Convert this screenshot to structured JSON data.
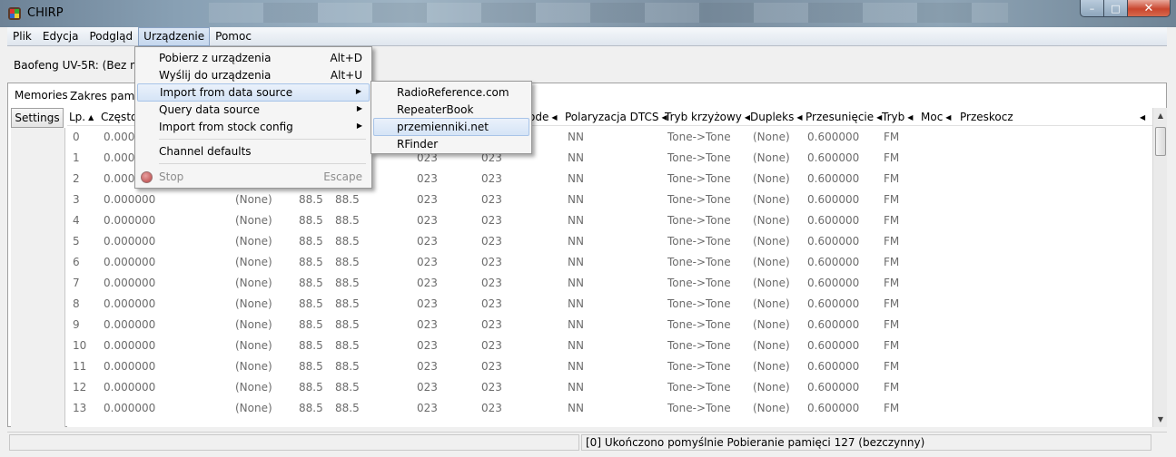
{
  "window": {
    "title": "CHIRP",
    "min": "–",
    "max": "□",
    "close": "✕"
  },
  "menubar": {
    "items": [
      "Plik",
      "Edycja",
      "Podgląd",
      "Urządzenie",
      "Pomoc"
    ]
  },
  "radio": {
    "label": "Baofeng UV-5R: (Bez nazw"
  },
  "tabs": {
    "memories": "Memories",
    "bank": "Zakres pamięć",
    "settings": "Settings"
  },
  "grid": {
    "headers": [
      "Lp.",
      "Częstot",
      "ode",
      "Polaryzacja DTCS",
      "Tryb krzyżowy",
      "Dupleks",
      "Przesunięcie",
      "Tryb",
      "Moc",
      "Przeskocz"
    ],
    "rows": [
      [
        "0",
        "0.00000",
        "",
        "",
        "",
        "",
        "",
        "NN",
        "Tone->Tone",
        "(None)",
        "0.600000",
        "FM"
      ],
      [
        "1",
        "0.00000",
        "",
        "",
        "",
        "023",
        "023",
        "NN",
        "Tone->Tone",
        "(None)",
        "0.600000",
        "FM"
      ],
      [
        "2",
        "0.00000",
        "",
        "",
        "",
        "023",
        "023",
        "NN",
        "Tone->Tone",
        "(None)",
        "0.600000",
        "FM"
      ],
      [
        "3",
        "0.000000",
        "(None)",
        "88.5",
        "88.5",
        "023",
        "023",
        "NN",
        "Tone->Tone",
        "(None)",
        "0.600000",
        "FM"
      ],
      [
        "4",
        "0.000000",
        "(None)",
        "88.5",
        "88.5",
        "023",
        "023",
        "NN",
        "Tone->Tone",
        "(None)",
        "0.600000",
        "FM"
      ],
      [
        "5",
        "0.000000",
        "(None)",
        "88.5",
        "88.5",
        "023",
        "023",
        "NN",
        "Tone->Tone",
        "(None)",
        "0.600000",
        "FM"
      ],
      [
        "6",
        "0.000000",
        "(None)",
        "88.5",
        "88.5",
        "023",
        "023",
        "NN",
        "Tone->Tone",
        "(None)",
        "0.600000",
        "FM"
      ],
      [
        "7",
        "0.000000",
        "(None)",
        "88.5",
        "88.5",
        "023",
        "023",
        "NN",
        "Tone->Tone",
        "(None)",
        "0.600000",
        "FM"
      ],
      [
        "8",
        "0.000000",
        "(None)",
        "88.5",
        "88.5",
        "023",
        "023",
        "NN",
        "Tone->Tone",
        "(None)",
        "0.600000",
        "FM"
      ],
      [
        "9",
        "0.000000",
        "(None)",
        "88.5",
        "88.5",
        "023",
        "023",
        "NN",
        "Tone->Tone",
        "(None)",
        "0.600000",
        "FM"
      ],
      [
        "10",
        "0.000000",
        "(None)",
        "88.5",
        "88.5",
        "023",
        "023",
        "NN",
        "Tone->Tone",
        "(None)",
        "0.600000",
        "FM"
      ],
      [
        "11",
        "0.000000",
        "(None)",
        "88.5",
        "88.5",
        "023",
        "023",
        "NN",
        "Tone->Tone",
        "(None)",
        "0.600000",
        "FM"
      ],
      [
        "12",
        "0.000000",
        "(None)",
        "88.5",
        "88.5",
        "023",
        "023",
        "NN",
        "Tone->Tone",
        "(None)",
        "0.600000",
        "FM"
      ],
      [
        "13",
        "0.000000",
        "(None)",
        "88.5",
        "88.5",
        "023",
        "023",
        "NN",
        "Tone->Tone",
        "(None)",
        "0.600000",
        "FM"
      ]
    ]
  },
  "status": {
    "text": "[0] Ukończono pomyślnie Pobieranie pamięci 127 (bezczynny)"
  },
  "device_menu": {
    "download": {
      "label": "Pobierz z urządzenia",
      "accel": "Alt+D"
    },
    "upload": {
      "label": "Wyślij do urządzenia",
      "accel": "Alt+U"
    },
    "import_source": {
      "label": "Import from data source"
    },
    "query_source": {
      "label": "Query data source"
    },
    "import_stock": {
      "label": "Import from stock config"
    },
    "channel_defaults": {
      "label": "Channel defaults"
    },
    "stop": {
      "label": "Stop",
      "accel": "Escape"
    }
  },
  "import_submenu": {
    "items": [
      "RadioReference.com",
      "RepeaterBook",
      "przemienniki.net",
      "RFinder"
    ]
  },
  "icons": {
    "submenu_arrow": "▶",
    "sort_asc": "▲",
    "col_arrow": "◀",
    "scroll_up": "▲",
    "scroll_down": "▼"
  }
}
